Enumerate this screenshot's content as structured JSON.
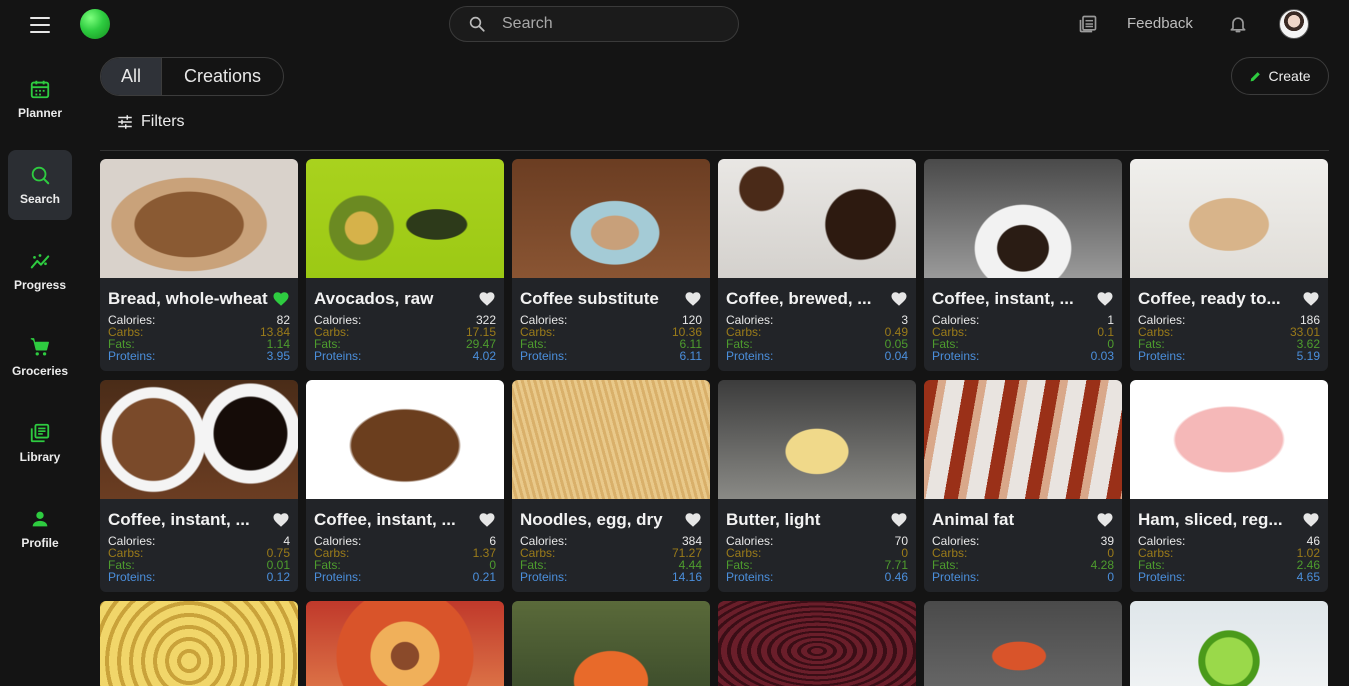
{
  "header": {
    "search_placeholder": "Search",
    "feedback_label": "Feedback"
  },
  "sidebar": {
    "items": [
      {
        "label": "Planner",
        "icon": "calendar-icon"
      },
      {
        "label": "Search",
        "icon": "search-icon",
        "active": true
      },
      {
        "label": "Progress",
        "icon": "progress-icon"
      },
      {
        "label": "Groceries",
        "icon": "cart-icon"
      },
      {
        "label": "Library",
        "icon": "library-icon"
      },
      {
        "label": "Profile",
        "icon": "person-icon"
      }
    ]
  },
  "tabs": {
    "all": "All",
    "creations": "Creations"
  },
  "create_label": "Create",
  "filters_label": "Filters",
  "stat_labels": {
    "calories": "Calories:",
    "carbs": "Carbs:",
    "fats": "Fats:",
    "proteins": "Proteins:"
  },
  "colors": {
    "accent": "#2ecc40",
    "carbs": "#9a7b1a",
    "fats": "#4e9c2e",
    "proteins": "#4b8fdc"
  },
  "foods": [
    {
      "title": "Bread, whole-wheat",
      "calories": "82",
      "carbs": "13.84",
      "fats": "1.14",
      "proteins": "3.95",
      "favorite": true
    },
    {
      "title": "Avocados, raw",
      "calories": "322",
      "carbs": "17.15",
      "fats": "29.47",
      "proteins": "4.02",
      "favorite": false
    },
    {
      "title": "Coffee substitute",
      "calories": "120",
      "carbs": "10.36",
      "fats": "6.11",
      "proteins": "6.11",
      "favorite": false
    },
    {
      "title": "Coffee, brewed, ...",
      "calories": "3",
      "carbs": "0.49",
      "fats": "0.05",
      "proteins": "0.04",
      "favorite": false
    },
    {
      "title": "Coffee, instant, ...",
      "calories": "1",
      "carbs": "0.1",
      "fats": "0",
      "proteins": "0.03",
      "favorite": false
    },
    {
      "title": "Coffee, ready to...",
      "calories": "186",
      "carbs": "33.01",
      "fats": "3.62",
      "proteins": "5.19",
      "favorite": false
    },
    {
      "title": "Coffee, instant, ...",
      "calories": "4",
      "carbs": "0.75",
      "fats": "0.01",
      "proteins": "0.12",
      "favorite": false
    },
    {
      "title": "Coffee, instant, ...",
      "calories": "6",
      "carbs": "1.37",
      "fats": "0",
      "proteins": "0.21",
      "favorite": false
    },
    {
      "title": "Noodles, egg, dry",
      "calories": "384",
      "carbs": "71.27",
      "fats": "4.44",
      "proteins": "14.16",
      "favorite": false
    },
    {
      "title": "Butter, light",
      "calories": "70",
      "carbs": "0",
      "fats": "7.71",
      "proteins": "0.46",
      "favorite": false
    },
    {
      "title": "Animal fat",
      "calories": "39",
      "carbs": "0",
      "fats": "4.28",
      "proteins": "0",
      "favorite": false
    },
    {
      "title": "Ham, sliced, reg...",
      "calories": "46",
      "carbs": "1.02",
      "fats": "2.46",
      "proteins": "4.65",
      "favorite": false
    }
  ]
}
